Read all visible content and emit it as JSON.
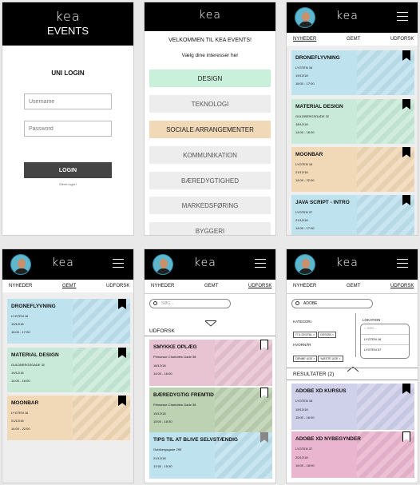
{
  "login": {
    "logo": "kea",
    "title": "EVENTS",
    "heading": "UNI LOGIN",
    "username_placeholder": "Username",
    "password_placeholder": "Password",
    "login_button": "LOGIN",
    "forgot": "Glemt login?"
  },
  "welcome": {
    "logo": "kea",
    "greeting": "VELKOMMEN TIL KEA EVENTS!",
    "instruction": "Vælg dine interesser her",
    "interests": [
      {
        "label": "DESIGN",
        "color": "#c9f0da"
      },
      {
        "label": "TEKNOLOGI",
        "color": "#ededed"
      },
      {
        "label": "SOCIALE ARRANGEMENTER",
        "color": "#f1d9b8"
      },
      {
        "label": "KOMMUNIKATION",
        "color": "#ededed"
      },
      {
        "label": "BÆREDYGTIGHED",
        "color": "#ededed"
      },
      {
        "label": "MARKEDSFØRING",
        "color": "#ededed"
      },
      {
        "label": "BYGGERI",
        "color": "#ededed"
      }
    ]
  },
  "nav": {
    "logo": "kea",
    "tabs": [
      "NYHEDER",
      "GEMT",
      "UDFORSK"
    ]
  },
  "news": {
    "events": [
      {
        "title": "DRONEFLYVNING",
        "place": "LYGTEN 16",
        "date": "19/12/18",
        "time": "16:00 - 17:00",
        "color": "blue"
      },
      {
        "title": "MATERIAL DESIGN",
        "place": "GULDBERGSGADE 32",
        "date": "18/12/18",
        "time": "14:00 - 16:00",
        "color": "green"
      },
      {
        "title": "MOONBAR",
        "place": "LYGTEN 16",
        "date": "21/12/18",
        "time": "14:00 - 22:00",
        "color": "orange"
      },
      {
        "title": "JAVA SCRIPT - INTRO",
        "place": "LYGTEN 37",
        "date": "21/12/18",
        "time": "14:00 - 17:00",
        "color": "blue"
      }
    ]
  },
  "saved": {
    "events": [
      {
        "title": "DRONEFLYVNING",
        "place": "LYGTEN 16",
        "date": "19/12/18",
        "time": "16:00 - 17:00",
        "color": "blue"
      },
      {
        "title": "MATERIAL DESIGN",
        "place": "GULDBERGSGADE 32",
        "date": "19/12/18",
        "time": "14:00 - 16:00",
        "color": "green"
      },
      {
        "title": "MOONBAR",
        "place": "LYGTEN 16",
        "date": "21/12/18",
        "time": "14:00 - 22:00",
        "color": "orange"
      }
    ]
  },
  "explore": {
    "search_placeholder": "SØG...",
    "heading": "UDFORSK",
    "events": [
      {
        "title": "SMYKKE OPLÆG",
        "place": "Prinsesse Charlottes Gade 38",
        "date": "18/12/18",
        "time": "14:00 - 16:00",
        "color": "pink"
      },
      {
        "title": "BÆREDYGTIG FREMTID",
        "place": "Prinsesse Charlottes Gade 38",
        "date": "19/12/18",
        "time": "15:00 - 18:30",
        "color": "sage"
      },
      {
        "title": "TIPS TIL AT BLIVE SELVSTÆNDIG",
        "place": "Guldbergsgade 29E",
        "date": "21/12/18",
        "time": "13:30 - 15:30",
        "color": "blue"
      }
    ]
  },
  "results": {
    "search_value": "ADOBE",
    "kategori_label": "KATEGORI",
    "kategori_chips": [
      "IT & DIGITAL",
      "DESIGN"
    ],
    "hvornaar_label": "HVORNÅR",
    "hvornaar_chips": [
      "DENNE UGE",
      "NÆSTE UGE"
    ],
    "lokation_label": "LOKATION",
    "lokation_placeholder": "SØG...",
    "lokation_options": [
      "LYGTEN 16",
      "LYGTEN 37"
    ],
    "heading": "RESULTATER (2)",
    "events": [
      {
        "title": "ADOBE XD KURSUS",
        "place": "LYGTEN 16",
        "date": "19/12/18",
        "time": "15:00 - 16:00",
        "color": "lavender"
      },
      {
        "title": "ADOBE XD NYBEGYNDER",
        "place": "LYGTEN 37",
        "date": "20/12/18",
        "time": "16:00 - 18:00",
        "color": "rose"
      }
    ]
  }
}
